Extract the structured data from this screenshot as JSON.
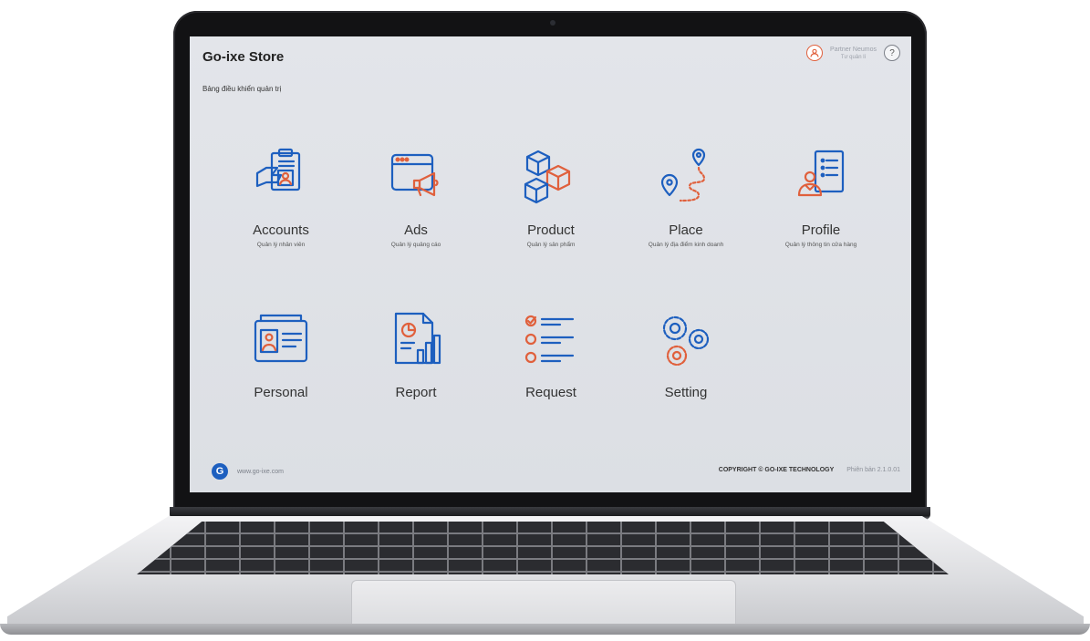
{
  "app": {
    "title": "Go-ixe Store",
    "subtitle": "Bảng điều khiển quản trị"
  },
  "user": {
    "name": "Partner Neumos",
    "role": "Tư quản lí",
    "help_symbol": "?"
  },
  "tiles": [
    {
      "label": "Accounts",
      "sub": "Quản lý nhân viên",
      "icon": "accounts-icon"
    },
    {
      "label": "Ads",
      "sub": "Quản lý quảng cáo",
      "icon": "ads-icon"
    },
    {
      "label": "Product",
      "sub": "Quản lý sản phẩm",
      "icon": "product-icon"
    },
    {
      "label": "Place",
      "sub": "Quản lý địa điểm kinh doanh",
      "icon": "place-icon"
    },
    {
      "label": "Profile",
      "sub": "Quản lý thông tin cửa hàng",
      "icon": "profile-icon"
    },
    {
      "label": "Personal",
      "sub": "",
      "icon": "personal-icon"
    },
    {
      "label": "Report",
      "sub": "",
      "icon": "report-icon"
    },
    {
      "label": "Request",
      "sub": "",
      "icon": "request-icon"
    },
    {
      "label": "Setting",
      "sub": "",
      "icon": "setting-icon"
    }
  ],
  "footer": {
    "logo_letter": "G",
    "url": "www.go-ixe.com",
    "copyright": "COPYRIGHT © GO-IXE TECHNOLOGY",
    "version": "Phiên bản 2.1.0.01"
  },
  "colors": {
    "blue": "#1d5fbf",
    "orange": "#e0603c"
  }
}
